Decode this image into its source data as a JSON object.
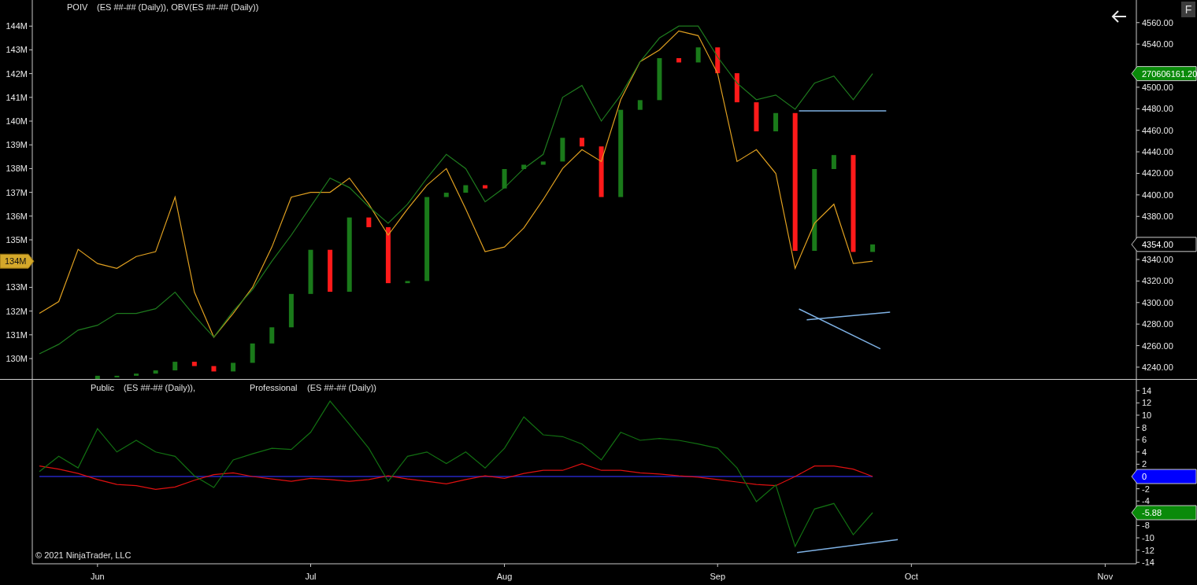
{
  "price_panel": {
    "legend": [
      "POIV",
      "(ES ##-## (Daily)), OBV(ES ##-## (Daily))"
    ],
    "indicators": {
      "chart_data": {
        "type": "line",
        "categories": [
          null,
          null,
          null,
          null,
          null,
          null,
          null,
          null,
          null,
          null,
          null,
          null,
          null,
          null,
          null,
          null,
          null,
          null,
          null,
          null,
          null,
          null,
          null,
          null,
          null,
          null,
          null,
          null,
          null,
          null,
          null,
          null,
          null,
          null,
          null,
          null,
          null,
          null,
          null,
          null,
          null,
          null,
          null,
          null,
          null,
          null,
          null,
          null,
          null,
          null,
          null,
          null,
          null,
          null,
          null,
          null,
          null
        ],
        "ylim": [
          129.14,
          145.1
        ],
        "yticks": [
          {
            "value": 144,
            "label": "144M"
          },
          {
            "value": 143,
            "label": "143M"
          },
          {
            "value": 142,
            "label": "142M"
          },
          {
            "value": 141,
            "label": "141M"
          },
          {
            "value": 140,
            "label": "140M"
          },
          {
            "value": 139,
            "label": "139M"
          },
          {
            "value": 138,
            "label": "138M"
          },
          {
            "value": 137,
            "label": "137M"
          },
          {
            "value": 136,
            "label": "136M"
          },
          {
            "value": 135,
            "label": "135M"
          },
          {
            "value": 133,
            "label": "133M"
          },
          {
            "value": 132,
            "label": "132M"
          },
          {
            "value": 131,
            "label": "131M"
          },
          {
            "value": 130,
            "label": "130M"
          }
        ],
        "series": [
          {
            "color": "#e0a020",
            "values": [
              131.9,
              132.4,
              134.6,
              134.0,
              133.8,
              134.3,
              134.5,
              136.8,
              132.8,
              130.9,
              131.9,
              133.0,
              134.7,
              136.8,
              137.0,
              137.0,
              137.6,
              136.5,
              135.2,
              136.3,
              137.3,
              138.0,
              136.3,
              134.5,
              134.7,
              135.5,
              136.7,
              138.0,
              138.8,
              138.3,
              140.9,
              142.5,
              143.0,
              143.8,
              143.6,
              142.0,
              138.3,
              138.8,
              137.8,
              133.8,
              135.7,
              136.5,
              134.0,
              134.1,
              null,
              null,
              null,
              null,
              null,
              null,
              null,
              null,
              null,
              null,
              null,
              null,
              null
            ]
          },
          {
            "color": "#1e7a1e",
            "values": [
              130.2,
              130.6,
              131.2,
              131.4,
              131.9,
              131.9,
              132.1,
              132.8,
              131.8,
              130.9,
              132.0,
              132.9,
              134.1,
              135.2,
              136.4,
              137.6,
              137.2,
              136.4,
              135.7,
              136.5,
              137.6,
              138.6,
              138.0,
              136.6,
              137.2,
              138.0,
              138.6,
              141.0,
              141.5,
              140.0,
              141.1,
              142.5,
              143.5,
              144.0,
              144.0,
              142.7,
              141.6,
              140.9,
              141.1,
              140.5,
              141.6,
              141.9,
              140.9,
              142.0,
              null,
              null,
              null,
              null,
              null,
              null,
              null,
              null,
              null,
              null,
              null,
              null,
              null
            ]
          }
        ]
      },
      "markers": [
        {
          "label": "134M",
          "color": "#d4a82a"
        },
        {
          "label": "270606161.20",
          "color": "#0a8a0a"
        }
      ]
    },
    "price": {
      "axis_labels": [
        "4560.00",
        "4540.00",
        "4500.00",
        "4480.00",
        "4460.00",
        "4440.00",
        "4420.00",
        "4400.00",
        "4380.00",
        "4340.00",
        "4320.00",
        "4300.00",
        "4280.00",
        "4260.00",
        "4240.00"
      ],
      "markers": [
        {
          "label": "4354.00",
          "color": "#000000"
        }
      ]
    }
  },
  "indicator_panel": {
    "legend": [
      "Public",
      "(ES ##-## (Daily)),",
      "Professional",
      "(ES ##-## (Daily))"
    ],
    "chart_data": {
      "type": "line",
      "categories": [
        null,
        null,
        null,
        "Jun",
        null,
        null,
        null,
        null,
        null,
        null,
        null,
        null,
        null,
        null,
        "Jul",
        null,
        null,
        null,
        null,
        null,
        null,
        null,
        null,
        null,
        "Aug",
        null,
        null,
        null,
        null,
        null,
        null,
        null,
        null,
        null,
        null,
        "Sep",
        null,
        null,
        null,
        null,
        null,
        null,
        null,
        null,
        null,
        "Oct",
        null,
        null,
        null,
        null,
        null,
        null,
        null,
        null,
        null,
        "Nov",
        null
      ],
      "ylim": [
        -14.23,
        15.77
      ],
      "yticks": [
        14,
        12,
        10,
        8,
        6,
        4,
        2,
        -2,
        -4,
        -8,
        -10,
        -12,
        -14
      ],
      "series": [
        {
          "color": "#e01010",
          "values": [
            1.7,
            1.2,
            0.5,
            -0.5,
            -1.3,
            -1.5,
            -2.1,
            -1.7,
            -0.6,
            0.3,
            0.6,
            0,
            -0.4,
            -0.8,
            -0.3,
            -0.5,
            -0.8,
            -0.5,
            0.1,
            -0.4,
            -0.8,
            -1.2,
            -0.5,
            0.1,
            -0.3,
            0.5,
            1.0,
            1.0,
            2.1,
            1.0,
            1.0,
            0.6,
            0.4,
            0.1,
            -0.1,
            -0.5,
            -0.9,
            -1.3,
            -1.5,
            0,
            1.7,
            1.7,
            1.2,
            0,
            null,
            null,
            null,
            null,
            null,
            null,
            null,
            null,
            null,
            null,
            null,
            null,
            null
          ]
        },
        {
          "color": "#127012",
          "values": [
            0.8,
            3.3,
            1.4,
            7.8,
            4.0,
            5.9,
            4.0,
            3.3,
            0.1,
            -1.8,
            2.7,
            3.7,
            4.6,
            4.4,
            7.2,
            12.3,
            8.5,
            4.6,
            -0.8,
            3.3,
            4.0,
            2.1,
            4.0,
            1.4,
            4.6,
            9.7,
            6.8,
            6.5,
            5.3,
            2.7,
            7.2,
            5.9,
            6.2,
            5.9,
            5.3,
            4.6,
            1.4,
            -4.1,
            -1.4,
            -11.4,
            -5.3,
            -4.4,
            -9.5,
            -5.9,
            null,
            null,
            null,
            null,
            null,
            null,
            null,
            null,
            null,
            null,
            null,
            null,
            null
          ]
        }
      ]
    },
    "markers": [
      {
        "label": "0",
        "color": "#0000ff"
      },
      {
        "label": "-5.88",
        "color": "#0a8a0a"
      }
    ]
  },
  "copyright": "© 2021 NinjaTrader, LLC",
  "button": {
    "label": "F"
  }
}
